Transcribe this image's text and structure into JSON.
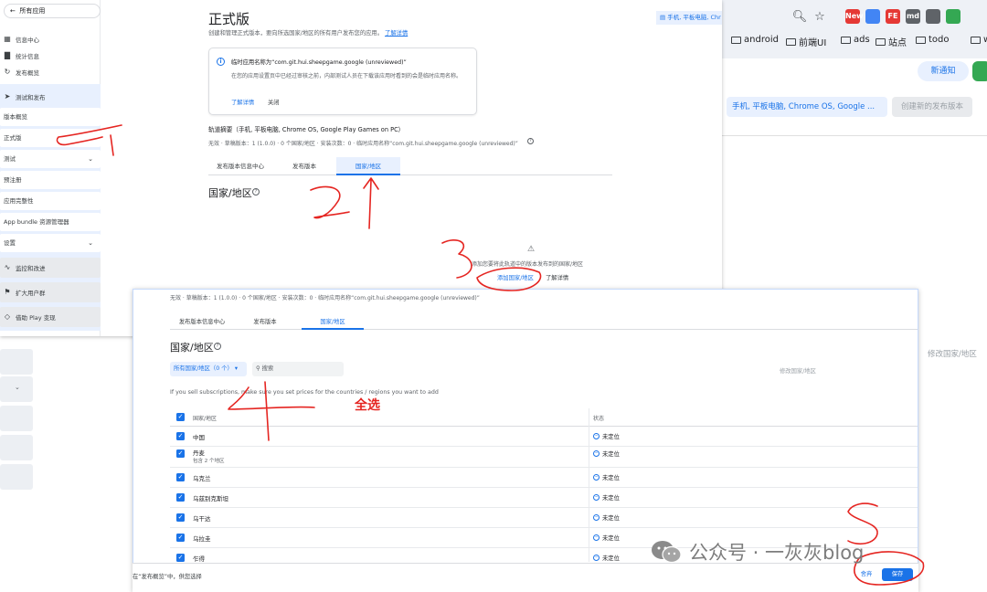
{
  "browser": {
    "toolbar_chip": "手机, 平板电脑, Chro",
    "bookmarks": [
      "android",
      "前端UI",
      "ads",
      "站点",
      "todo",
      "win"
    ],
    "extensions": [
      {
        "name": "new-badge",
        "label": "New",
        "color": "#e53935"
      },
      {
        "name": "translate",
        "label": "",
        "color": "#4285f4"
      },
      {
        "name": "fe",
        "label": "FE",
        "color": "#e53935"
      },
      {
        "name": "md",
        "label": "md",
        "color": "#5f6368"
      },
      {
        "name": "qr",
        "label": "",
        "color": "#5f6368"
      },
      {
        "name": "stats",
        "label": "",
        "color": "#34a853"
      }
    ]
  },
  "background_console": {
    "notify_label": "新通知",
    "device_selector": "手机, 平板电脑, Chrome OS, Google ...",
    "create_release": "创建新的发布版本",
    "edit_regions": "修改国家/地区"
  },
  "sidebar": {
    "back_label": "所有应用",
    "top_items": [
      {
        "icon": "dashboard-icon",
        "label": "信息中心"
      },
      {
        "icon": "bar-chart-icon",
        "label": "统计信息"
      },
      {
        "icon": "publish-icon",
        "label": "发布概览"
      }
    ],
    "group_label": "测试和发布",
    "group_items": [
      {
        "label": "版本概览",
        "chevron": false
      },
      {
        "label": "正式版",
        "chevron": false
      },
      {
        "label": "测试",
        "chevron": true
      },
      {
        "label": "预注册",
        "chevron": false
      },
      {
        "label": "应用完整性",
        "chevron": false
      },
      {
        "label": "App bundle 资源管理器",
        "chevron": false
      },
      {
        "label": "设置",
        "chevron": true
      }
    ],
    "lower_items": [
      {
        "icon": "monitor-icon",
        "label": "监控和改进"
      },
      {
        "icon": "grow-users-icon",
        "label": "扩大用户群"
      },
      {
        "icon": "tag-icon",
        "label": "借助 Play 变现"
      }
    ]
  },
  "release": {
    "title": "正式版",
    "description": "创建和管理正式版本，要向所选国家/地区的所有用户发布您的应用。",
    "description_link": "了解详情",
    "device_chip": "手机, 平板电脑, Chr",
    "notice": {
      "title": "临时应用名称为“com.git.hui.sheepgame.google (unreviewed)”",
      "body": "在您的应用设置页中已经过审核之前，内部测试人员在下载该应用时看到的会是临时应用名称。",
      "learn_more": "了解详情",
      "close": "关闭"
    },
    "track_title": "轨道摘要（手机, 平板电脑, Chrome OS, Google Play Games on PC）",
    "track_meta": "无效 · 草稿版本：1 (1.0.0) · 0 个国家/地区 · 安装次数：0 · 临时应用名称“com.git.hui.sheepgame.google (unreviewed)”",
    "tabs": [
      "发布版本信息中心",
      "发布版本",
      "国家/地区"
    ],
    "region_heading": "国家/地区",
    "empty_message": "添加您要将此轨道中的版本发布到的国家/地区",
    "add_region": "添加国家/地区",
    "learn_more": "了解详情"
  },
  "selection": {
    "meta": "无效 · 草稿版本：1 (1.0.0) · 0 个国家/地区 · 安装次数：0 · 临时应用名称“com.git.hui.sheepgame.google (unreviewed)”",
    "tabs": [
      "发布版本信息中心",
      "发布版本",
      "国家/地区"
    ],
    "region_heading": "国家/地区",
    "filter_label": "所有国家/地区（0 个）",
    "search_placeholder": "搜索",
    "edit_regions": "修改国家/地区",
    "subscription_note": "If you sell subscriptions, make sure you set prices for the countries / regions you want to add",
    "columns": [
      "国家/地区",
      "状态"
    ],
    "rows": [
      {
        "name": "中国",
        "sub": "",
        "status": "未定位"
      },
      {
        "name": "丹麦",
        "sub": "包含 2 个地区",
        "status": "未定位"
      },
      {
        "name": "乌克兰",
        "sub": "",
        "status": "未定位"
      },
      {
        "name": "乌兹别克斯坦",
        "sub": "",
        "status": "未定位"
      },
      {
        "name": "乌干达",
        "sub": "",
        "status": "未定位"
      },
      {
        "name": "乌拉圭",
        "sub": "",
        "status": "未定位"
      },
      {
        "name": "乍得",
        "sub": "",
        "status": "未定位"
      }
    ],
    "footer_note": "在“发布概览”中，供您选择",
    "discard": "舍弃",
    "save": "保存"
  },
  "annotations": {
    "select_all": "全选",
    "color": "#e52521"
  },
  "watermark": {
    "text": "公众号 · 一灰灰blog"
  }
}
